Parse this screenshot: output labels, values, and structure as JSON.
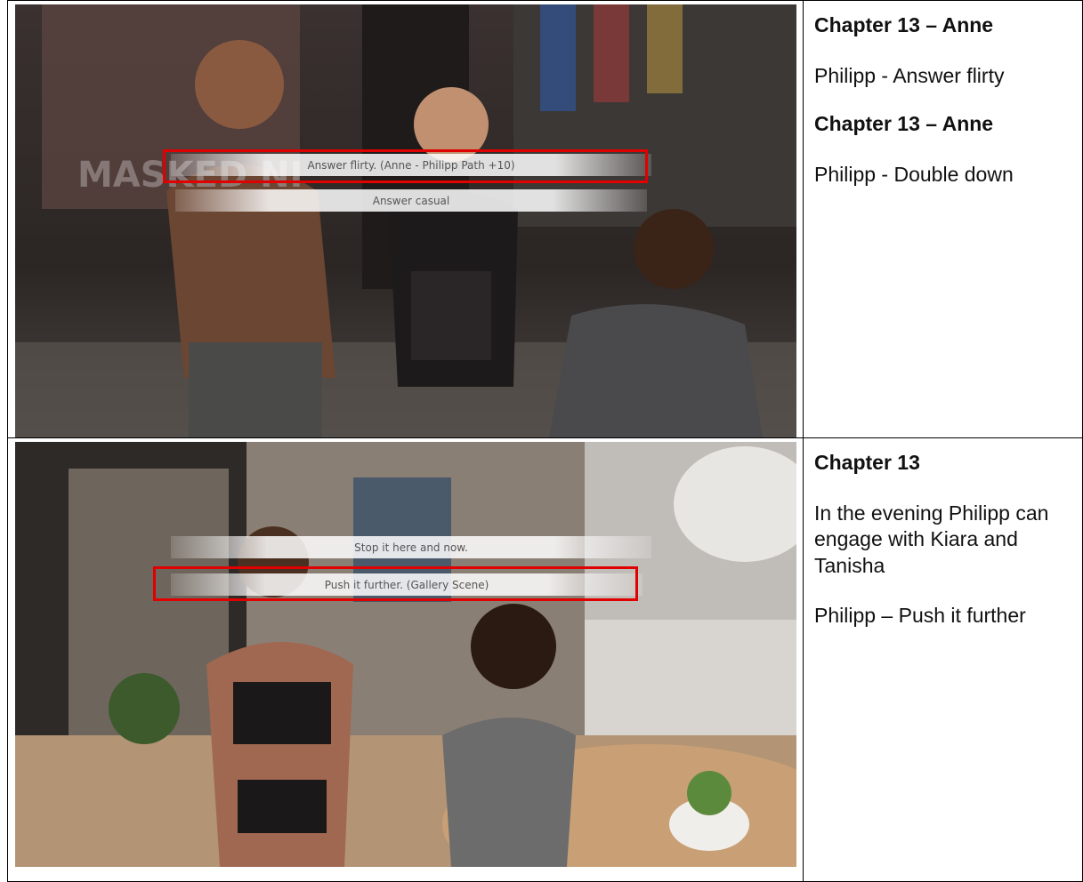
{
  "rows": [
    {
      "screenshot": {
        "scene": "boutique",
        "choices": [
          "Answer flirty. (Anne - Philipp Path +10)",
          "Answer casual"
        ],
        "highlighted_choice": 0,
        "poster_text": "MASKED NI"
      },
      "notes": [
        {
          "type": "title",
          "text": "Chapter 13 – Anne"
        },
        {
          "type": "line",
          "text": "Philipp - Answer flirty"
        },
        {
          "type": "title",
          "text": "Chapter 13 – Anne"
        },
        {
          "type": "line",
          "text": "Philipp - Double down"
        }
      ]
    },
    {
      "screenshot": {
        "scene": "apartment",
        "choices": [
          "Stop it here and now.",
          "Push it further. (Gallery Scene)"
        ],
        "highlighted_choice": 1
      },
      "notes": [
        {
          "type": "title",
          "text": "Chapter 13"
        },
        {
          "type": "line",
          "text": "In the evening Philipp can engage with Kiara and Tanisha"
        },
        {
          "type": "line",
          "text": "Philipp – Push it further"
        }
      ]
    }
  ],
  "colors": {
    "highlight": "#e00000",
    "border": "#000000"
  }
}
